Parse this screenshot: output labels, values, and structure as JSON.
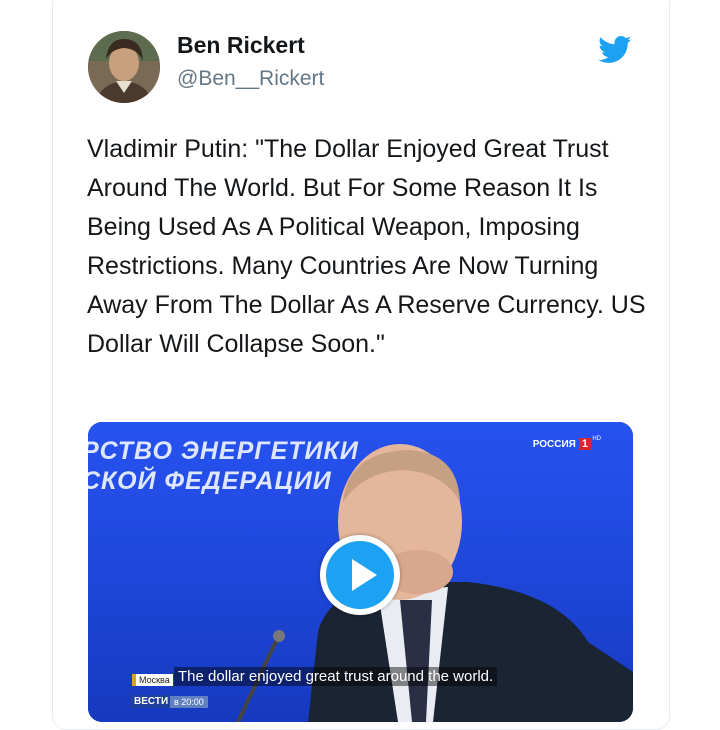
{
  "author": {
    "name": "Ben Rickert",
    "handle": "@Ben__Rickert"
  },
  "icons": {
    "platform": "twitter-bird-icon",
    "avatar": "avatar-photo",
    "play": "play-icon"
  },
  "tweet": {
    "text": "Vladimir Putin: \"The Dollar Enjoyed Great Trust Around The World. But For Some Reason It Is Being Used As A Political Weapon, Imposing Restrictions. Many Countries Are Now Turning Away From The Dollar As A Reserve Currency. US Dollar Will Collapse Soon.\""
  },
  "video": {
    "backdrop_line1": "РСТВО ЭНЕРГЕТИКИ",
    "backdrop_line2": "СКОЙ ФЕДЕРАЦИИ",
    "channel_name": "РОССИЯ",
    "channel_number": "1",
    "channel_hd": "HD",
    "location": "Москва",
    "subtitle": "The dollar enjoyed great trust around the world.",
    "program": "ВЕСТИ",
    "program_time": "в 20:00"
  },
  "colors": {
    "brand": "#1da1f2",
    "text": "#14171a",
    "secondary_text": "#657786",
    "video_background": "#1a3fd6"
  }
}
